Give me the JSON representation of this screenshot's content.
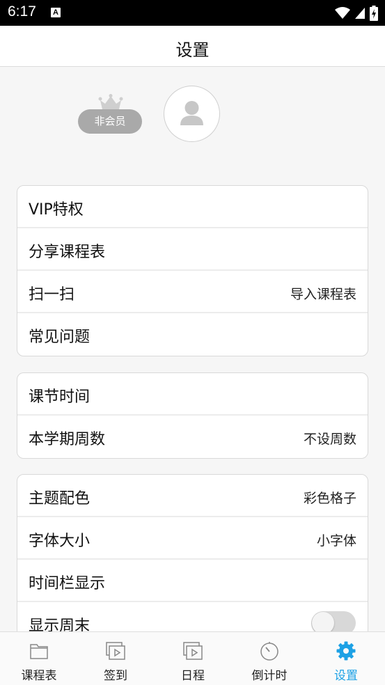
{
  "status": {
    "time": "6:17",
    "notif_icon": "A"
  },
  "header": {
    "title": "设置"
  },
  "profile": {
    "membership": "非会员",
    "avatar_icon": "person-icon",
    "crown_icon": "crown-icon"
  },
  "sections": [
    {
      "rows": [
        {
          "label": "VIP特权",
          "value": ""
        },
        {
          "label": "分享课程表",
          "value": ""
        },
        {
          "label": "扫一扫",
          "value": "导入课程表"
        },
        {
          "label": "常见问题",
          "value": ""
        }
      ]
    },
    {
      "rows": [
        {
          "label": "课节时间",
          "value": ""
        },
        {
          "label": "本学期周数",
          "value": "不设周数"
        }
      ]
    },
    {
      "rows": [
        {
          "label": "主题配色",
          "value": "彩色格子"
        },
        {
          "label": "字体大小",
          "value": "小字体"
        },
        {
          "label": "时间栏显示",
          "value": ""
        },
        {
          "label": "显示周末",
          "value": "",
          "toggle": false
        }
      ]
    }
  ],
  "tabs": [
    {
      "label": "课程表",
      "icon": "folder-icon",
      "active": false
    },
    {
      "label": "签到",
      "icon": "video-stack-icon",
      "active": false
    },
    {
      "label": "日程",
      "icon": "video-stack-icon",
      "active": false
    },
    {
      "label": "倒计时",
      "icon": "stopwatch-icon",
      "active": false
    },
    {
      "label": "设置",
      "icon": "gear-icon",
      "active": true
    }
  ],
  "colors": {
    "accent": "#1da1e5",
    "badge": "#a9a9a9"
  }
}
